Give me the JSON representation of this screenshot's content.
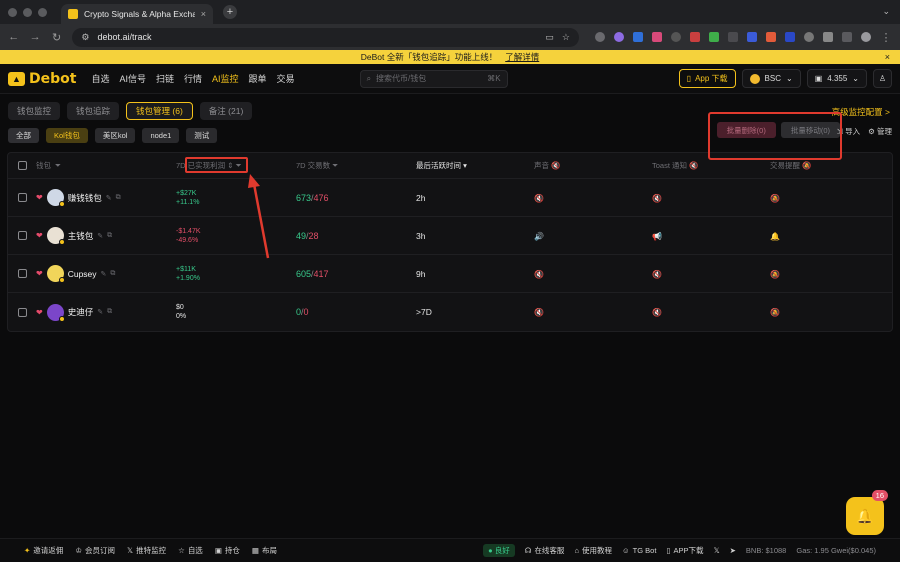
{
  "browser": {
    "tab_title": "Crypto Signals & Alpha Exchange",
    "tab_close": "×",
    "new_tab": "+",
    "url": "debot.ai/track"
  },
  "announcement": {
    "text": "DeBot 全新「钱包追踪」功能上线！",
    "link": "了解详情",
    "close": "×"
  },
  "header": {
    "logo": "Debot",
    "nav": [
      "自选",
      "AI信号",
      "扫链",
      "行情",
      "AI监控",
      "跟单",
      "交易"
    ],
    "active_nav": "AI监控",
    "search_placeholder": "搜索代币/钱包",
    "search_shortcut": "⌘K",
    "app_download": "App 下载",
    "chain": "BSC",
    "balance": "4.355"
  },
  "subtabs": [
    {
      "label": "钱包监控",
      "active": false
    },
    {
      "label": "钱包追踪",
      "active": false
    },
    {
      "label": "钱包管理 (6)",
      "active": true
    },
    {
      "label": "备注 (21)",
      "active": false
    }
  ],
  "advanced_config": "高级监控配置 >",
  "groups": [
    {
      "label": "全部",
      "active": false
    },
    {
      "label": "Kol钱包",
      "active": true
    },
    {
      "label": "美区kol",
      "active": false
    },
    {
      "label": "node1",
      "active": false
    },
    {
      "label": "测试",
      "active": false
    }
  ],
  "batch": {
    "delete": "批量删除(0)",
    "move": "批量移动(0)"
  },
  "tools": {
    "import": "导入",
    "manage": "管理"
  },
  "columns": {
    "wallet": "钱包",
    "pnl": "7D 已实现利润",
    "tx": "7D 交易数",
    "last_active": "最后活跃时间",
    "sound": "声音",
    "toast": "Toast 通知",
    "remind": "交易提醒"
  },
  "rows": [
    {
      "name": "赚钱钱包",
      "pnl_usd": "+$27K",
      "pnl_pct": "+11.1%",
      "pnl_dir": "up",
      "buys": "673",
      "sells": "476",
      "last": "2h",
      "avatar_bg": "#cfd8e6",
      "sound_on": false
    },
    {
      "name": "主钱包",
      "pnl_usd": "-$1.47K",
      "pnl_pct": "-49.6%",
      "pnl_dir": "down",
      "buys": "49",
      "sells": "28",
      "last": "3h",
      "avatar_bg": "#e9e1d4",
      "sound_on": true
    },
    {
      "name": "Cupsey",
      "pnl_usd": "+$11K",
      "pnl_pct": "+1.90%",
      "pnl_dir": "up",
      "buys": "605",
      "sells": "417",
      "last": "9h",
      "avatar_bg": "#f1d55a",
      "sound_on": false
    },
    {
      "name": "史迪仔",
      "pnl_usd": "$0",
      "pnl_pct": "0%",
      "pnl_dir": "neutral",
      "buys": "0",
      "sells": "0",
      "last": ">7D",
      "avatar_bg": "#7b46c9",
      "sound_on": false
    }
  ],
  "bell_badge": "16",
  "footer": {
    "left": [
      "邀请返佣",
      "会员订阅",
      "推特监控",
      "自选",
      "持仓",
      "布局"
    ],
    "status": "良好",
    "right": [
      "在线客服",
      "使用教程",
      "TG Bot",
      "APP下载"
    ],
    "bnb_price": "BNB: $1088",
    "gas": "Gas: 1.95 Gwei($0.045)"
  },
  "colors": {
    "accent": "#f4c21b",
    "up": "#38c98b",
    "down": "#e24f67",
    "annotation": "#e03a2e"
  }
}
